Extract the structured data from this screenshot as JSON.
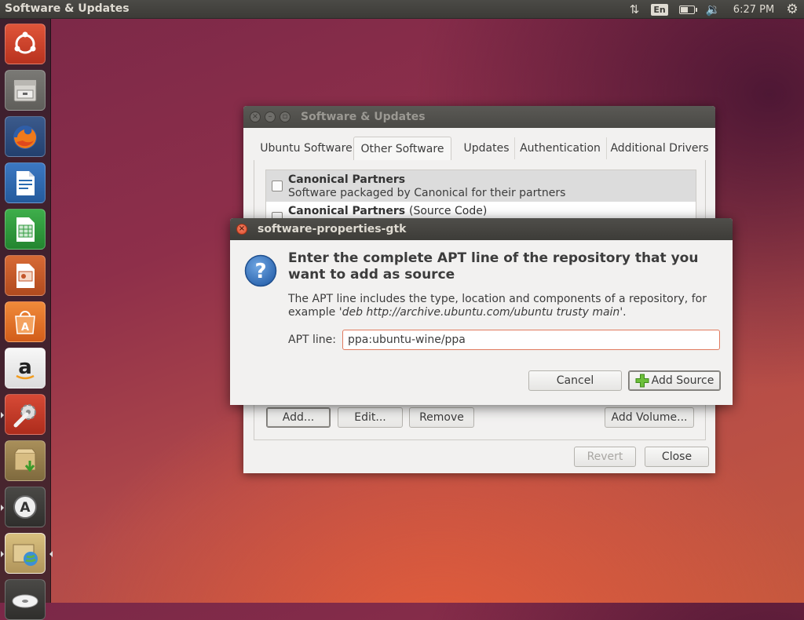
{
  "top_panel": {
    "app_title": "Software & Updates",
    "language": "En",
    "battery_level": 0.6,
    "clock": "6:27 PM"
  },
  "launcher": {
    "items": [
      {
        "name": "dash-home",
        "icon": "ubuntu-logo-icon",
        "color": "#d9442e"
      },
      {
        "name": "files",
        "icon": "file-cabinet-icon",
        "color": "#8c8a86"
      },
      {
        "name": "firefox",
        "icon": "firefox-icon",
        "color": "#e66000"
      },
      {
        "name": "libreoffice-writer",
        "icon": "writer-icon",
        "color": "#2a6bb1"
      },
      {
        "name": "libreoffice-calc",
        "icon": "calc-icon",
        "color": "#2f9a3d"
      },
      {
        "name": "libreoffice-impress",
        "icon": "impress-icon",
        "color": "#c3562a"
      },
      {
        "name": "ubuntu-software-center",
        "icon": "software-center-icon",
        "color": "#e8712c"
      },
      {
        "name": "amazon",
        "icon": "amazon-icon",
        "color": "#f0f0f0"
      },
      {
        "name": "system-settings",
        "icon": "settings-icon",
        "color": "#cc3b2a"
      },
      {
        "name": "software-updater",
        "icon": "package-download-icon",
        "color": "#c8a96a"
      },
      {
        "name": "software-updates-a",
        "icon": "updater-icon",
        "color": "#4a4a4a"
      },
      {
        "name": "software-properties",
        "icon": "package-globe-icon",
        "color": "#cdb373"
      },
      {
        "name": "disc",
        "icon": "disc-icon",
        "color": "#e8e8e8"
      }
    ]
  },
  "main_window": {
    "title": "Software & Updates",
    "tabs": [
      {
        "label": "Ubuntu Software"
      },
      {
        "label": "Other Software"
      },
      {
        "label": "Updates"
      },
      {
        "label": "Authentication"
      },
      {
        "label": "Additional Drivers"
      }
    ],
    "repos": [
      {
        "title": "Canonical Partners",
        "subtitle": "Software packaged by Canonical for their partners"
      },
      {
        "title": "Canonical Partners",
        "title_suffix": "(Source Code)"
      }
    ],
    "buttons": {
      "add": "Add...",
      "edit": "Edit...",
      "remove": "Remove",
      "add_volume": "Add Volume...",
      "revert": "Revert",
      "close": "Close"
    }
  },
  "dialog": {
    "title": "software-properties-gtk",
    "heading": "Enter the complete APT line of the repository that you want to add as source",
    "body_prefix": "The APT line includes the type, location and components of a repository, for example  '",
    "body_example": "deb http://archive.ubuntu.com/ubuntu trusty main",
    "body_suffix": "'.",
    "apt_label": "APT line:",
    "apt_value": "ppa:ubuntu-wine/ppa",
    "cancel": "Cancel",
    "add_source": "Add Source"
  }
}
